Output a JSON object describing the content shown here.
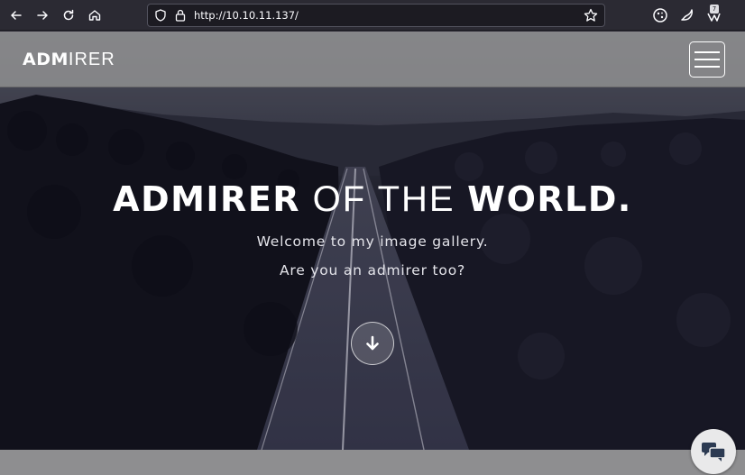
{
  "browser": {
    "url": "http://10.10.11.137/",
    "extension_badge": "7"
  },
  "site": {
    "brand_bold": "ADM",
    "brand_light": "IRER",
    "headline_bold_1": "ADMIRER",
    "headline_thin": "OF THE",
    "headline_bold_2": "WORLD.",
    "subtitle_1": "Welcome to my image gallery.",
    "subtitle_2": "Are you an admirer too?"
  },
  "icons": {
    "back": "arrow-left-icon",
    "forward": "arrow-right-icon",
    "reload": "reload-icon",
    "home": "home-icon",
    "menu": "hamburger-icon",
    "scroll": "arrow-down-icon",
    "chat": "chat-bubbles-icon"
  },
  "colors": {
    "toolbar_bg": "#2b2a33",
    "navbar_bg": "#969696",
    "text": "#ffffff"
  }
}
